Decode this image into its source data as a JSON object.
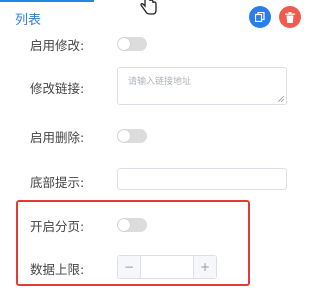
{
  "header": {
    "title": "列表"
  },
  "fields": {
    "enable_edit_label": "启用修改:",
    "edit_link_label": "修改链接:",
    "edit_link_placeholder": "请输入链接地址",
    "enable_delete_label": "启用删除:",
    "footer_tip_label": "底部提示:",
    "enable_paging_label": "开启分页:",
    "data_limit_label": "数据上限:",
    "data_limit_minus": "−",
    "data_limit_plus": "+"
  },
  "toggles": {
    "enable_edit": false,
    "enable_delete": false,
    "enable_paging": false
  },
  "icons": {
    "copy": "copy-icon",
    "delete": "trash-icon",
    "cursor": "hand-pointer-icon"
  },
  "colors": {
    "accent": "#2f7fd8",
    "copy_button": "#2b7de9",
    "delete_button": "#f05a4f",
    "highlight_box": "#e53935"
  }
}
